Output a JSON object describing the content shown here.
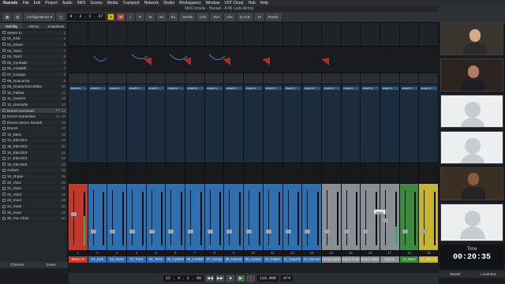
{
  "menu": {
    "app": "Nuendo",
    "items": [
      "File",
      "Edit",
      "Project",
      "Audio",
      "MIDI",
      "Scores",
      "Media",
      "Transport",
      "Network",
      "Studio",
      "Workspaces",
      "Window",
      "VST Cloud",
      "Hub",
      "Help"
    ]
  },
  "window_title": "MixConsole - Hazael - A Mi Lado Almos",
  "toolbar": {
    "configurations": "Configurations",
    "time": "4 . 3 . 1 . 37",
    "timecode": "12 . 4 . 1 . 98",
    "link": "Link",
    "sve": "Sve",
    "abs": "Abs",
    "qlink": "Q-Link",
    "bank": "19",
    "racks": "Racks"
  },
  "left_panel": {
    "tabs": [
      "Visibility",
      "History",
      "Snapshots"
    ],
    "channels": [
      {
        "name": "Stereo In",
        "num": "1"
      },
      {
        "name": "01_Kick",
        "num": "2"
      },
      {
        "name": "02_Snare",
        "num": "3"
      },
      {
        "name": "03_Tom1",
        "num": "4"
      },
      {
        "name": "04_Tom2",
        "num": "5"
      },
      {
        "name": "05_Cymbals",
        "num": "6"
      },
      {
        "name": "06_Cowbell",
        "num": "7"
      },
      {
        "name": "07_Congas",
        "num": "8"
      },
      {
        "name": "08_Guacacha",
        "num": "9"
      },
      {
        "name": "09_GuarachaCumbia",
        "num": "10"
      },
      {
        "name": "10_Palitos",
        "num": "11"
      },
      {
        "name": "11_Guache",
        "num": "12"
      },
      {
        "name": "12_Llamador",
        "num": "13"
      },
      {
        "name": "Drums Surround",
        "num": "14"
      },
      {
        "name": "Drums Immersive",
        "num": "15"
      },
      {
        "name": "Drums Stereo Reverb",
        "num": "16"
      },
      {
        "name": "Drums",
        "num": "17"
      },
      {
        "name": "13_Bass",
        "num": "18"
      },
      {
        "name": "14_ElecGtr1",
        "num": "19"
      },
      {
        "name": "15_ElecGtr2",
        "num": "20"
      },
      {
        "name": "16_ElecGtr3",
        "num": "21"
      },
      {
        "name": "17_ElecGtr4",
        "num": "22"
      },
      {
        "name": "18_ElecGtr5",
        "num": "23"
      },
      {
        "name": "Guitars",
        "num": "24"
      },
      {
        "name": "19_Organ",
        "num": "25"
      },
      {
        "name": "20_Vox1",
        "num": "26"
      },
      {
        "name": "21_Vox2",
        "num": "27"
      },
      {
        "name": "22_Vox3",
        "num": "28"
      },
      {
        "name": "23_Vox4",
        "num": "29"
      },
      {
        "name": "24_Vox5",
        "num": "30"
      },
      {
        "name": "25_Vox6",
        "num": "31"
      },
      {
        "name": "30_Vox Choir",
        "num": "32"
      }
    ],
    "bottom_tabs": [
      "Channel",
      "Zones"
    ]
  },
  "strips": [
    {
      "name": "Stereo In",
      "num": "1",
      "color": "#c0392b",
      "level": 0.55
    },
    {
      "name": "01_Kick",
      "num": "2",
      "color": "#2f6fb0",
      "level": 0.0
    },
    {
      "name": "02_Snare",
      "num": "3",
      "color": "#2f6fb0",
      "level": 0.0
    },
    {
      "name": "03_Tom1",
      "num": "4",
      "color": "#2f6fb0",
      "level": 0.0
    },
    {
      "name": "04_Tom2",
      "num": "5",
      "color": "#2f6fb0",
      "level": 0.0
    },
    {
      "name": "05_Cymbal",
      "num": "6",
      "color": "#2f6fb0",
      "level": 0.0
    },
    {
      "name": "06_Cowbel",
      "num": "7",
      "color": "#2f6fb0",
      "level": 0.0
    },
    {
      "name": "07_Conga",
      "num": "8",
      "color": "#2f6fb0",
      "level": 0.0
    },
    {
      "name": "08_Guacac",
      "num": "9",
      "color": "#2f6fb0",
      "level": 0.0
    },
    {
      "name": "09_Guarac",
      "num": "10",
      "color": "#2f6fb0",
      "level": 0.0
    },
    {
      "name": "10_Palitos",
      "num": "11",
      "color": "#2f6fb0",
      "level": 0.0
    },
    {
      "name": "11_Guache",
      "num": "12",
      "color": "#2f6fb0",
      "level": 0.0
    },
    {
      "name": "12_Llamad",
      "num": "13",
      "color": "#2f6fb0",
      "level": 0.0
    },
    {
      "name": "Drums Surround",
      "num": "14",
      "color": "#8a8f95",
      "level": 0.0
    },
    {
      "name": "Drums Immersive",
      "num": "15",
      "color": "#8a8f95",
      "level": 0.0
    },
    {
      "name": "Drums Stereo",
      "num": "16",
      "color": "#8a8f95",
      "level": 0.0
    },
    {
      "name": "Drums",
      "num": "17",
      "color": "#8a8f95",
      "level": 0.35
    },
    {
      "name": "13_Bass",
      "num": "18",
      "color": "#3b8a3e",
      "level": 0.0
    },
    {
      "name": "14_ElecGtr",
      "num": "19",
      "color": "#c7b531",
      "level": 0.0
    }
  ],
  "insert_label": "INSERTS",
  "tooltip": "Mute",
  "transport": {
    "time": "12 . 4 . 1 . 98",
    "tempo": "118.000",
    "signature": "4/4"
  },
  "right_panel": {
    "timer_label": "Time",
    "timer_value": "00:20:35",
    "tabs": [
      "Master",
      "Loudness"
    ]
  }
}
